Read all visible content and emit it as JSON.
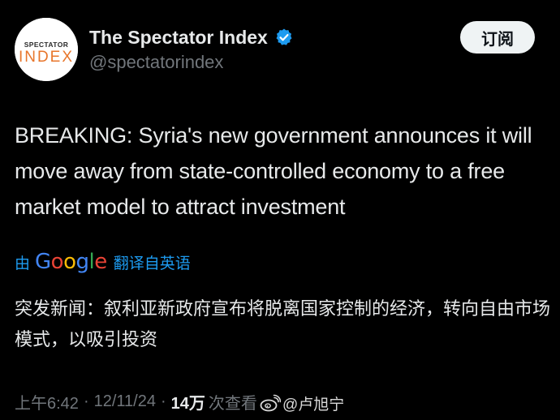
{
  "account": {
    "avatar_text_top": "SPECTATOR",
    "avatar_text_bottom": "INDEX",
    "display_name": "The Spectator Index",
    "handle": "@spectatorindex",
    "verified_icon": "verified-badge-icon",
    "follow_label": "订阅"
  },
  "tweet": {
    "text": "BREAKING: Syria's new government announces it will move away from state-controlled economy to a free market model to attract investment"
  },
  "translation": {
    "by_label": "由",
    "provider": "Google",
    "from_label": "翻译自英语",
    "text": "突发新闻：叙利亚新政府宣布将脱离国家控制的经济，转向自由市场模式，以吸引投资"
  },
  "meta": {
    "time": "上午6:42",
    "separator": "·",
    "date": "12/11/24",
    "views_count": "14万",
    "views_label": "次查看"
  },
  "watermark": {
    "icon": "weibo-icon",
    "text": "@卢旭宁"
  },
  "colors": {
    "background": "#000000",
    "text_primary": "#e7e9ea",
    "text_secondary": "#71767b",
    "link_blue": "#1d9bf0",
    "verified_blue": "#1d9bf0",
    "brand_orange": "#e8762b",
    "google_blue": "#4285f4",
    "google_red": "#ea4335",
    "google_yellow": "#fbbc05",
    "google_green": "#34a853"
  }
}
